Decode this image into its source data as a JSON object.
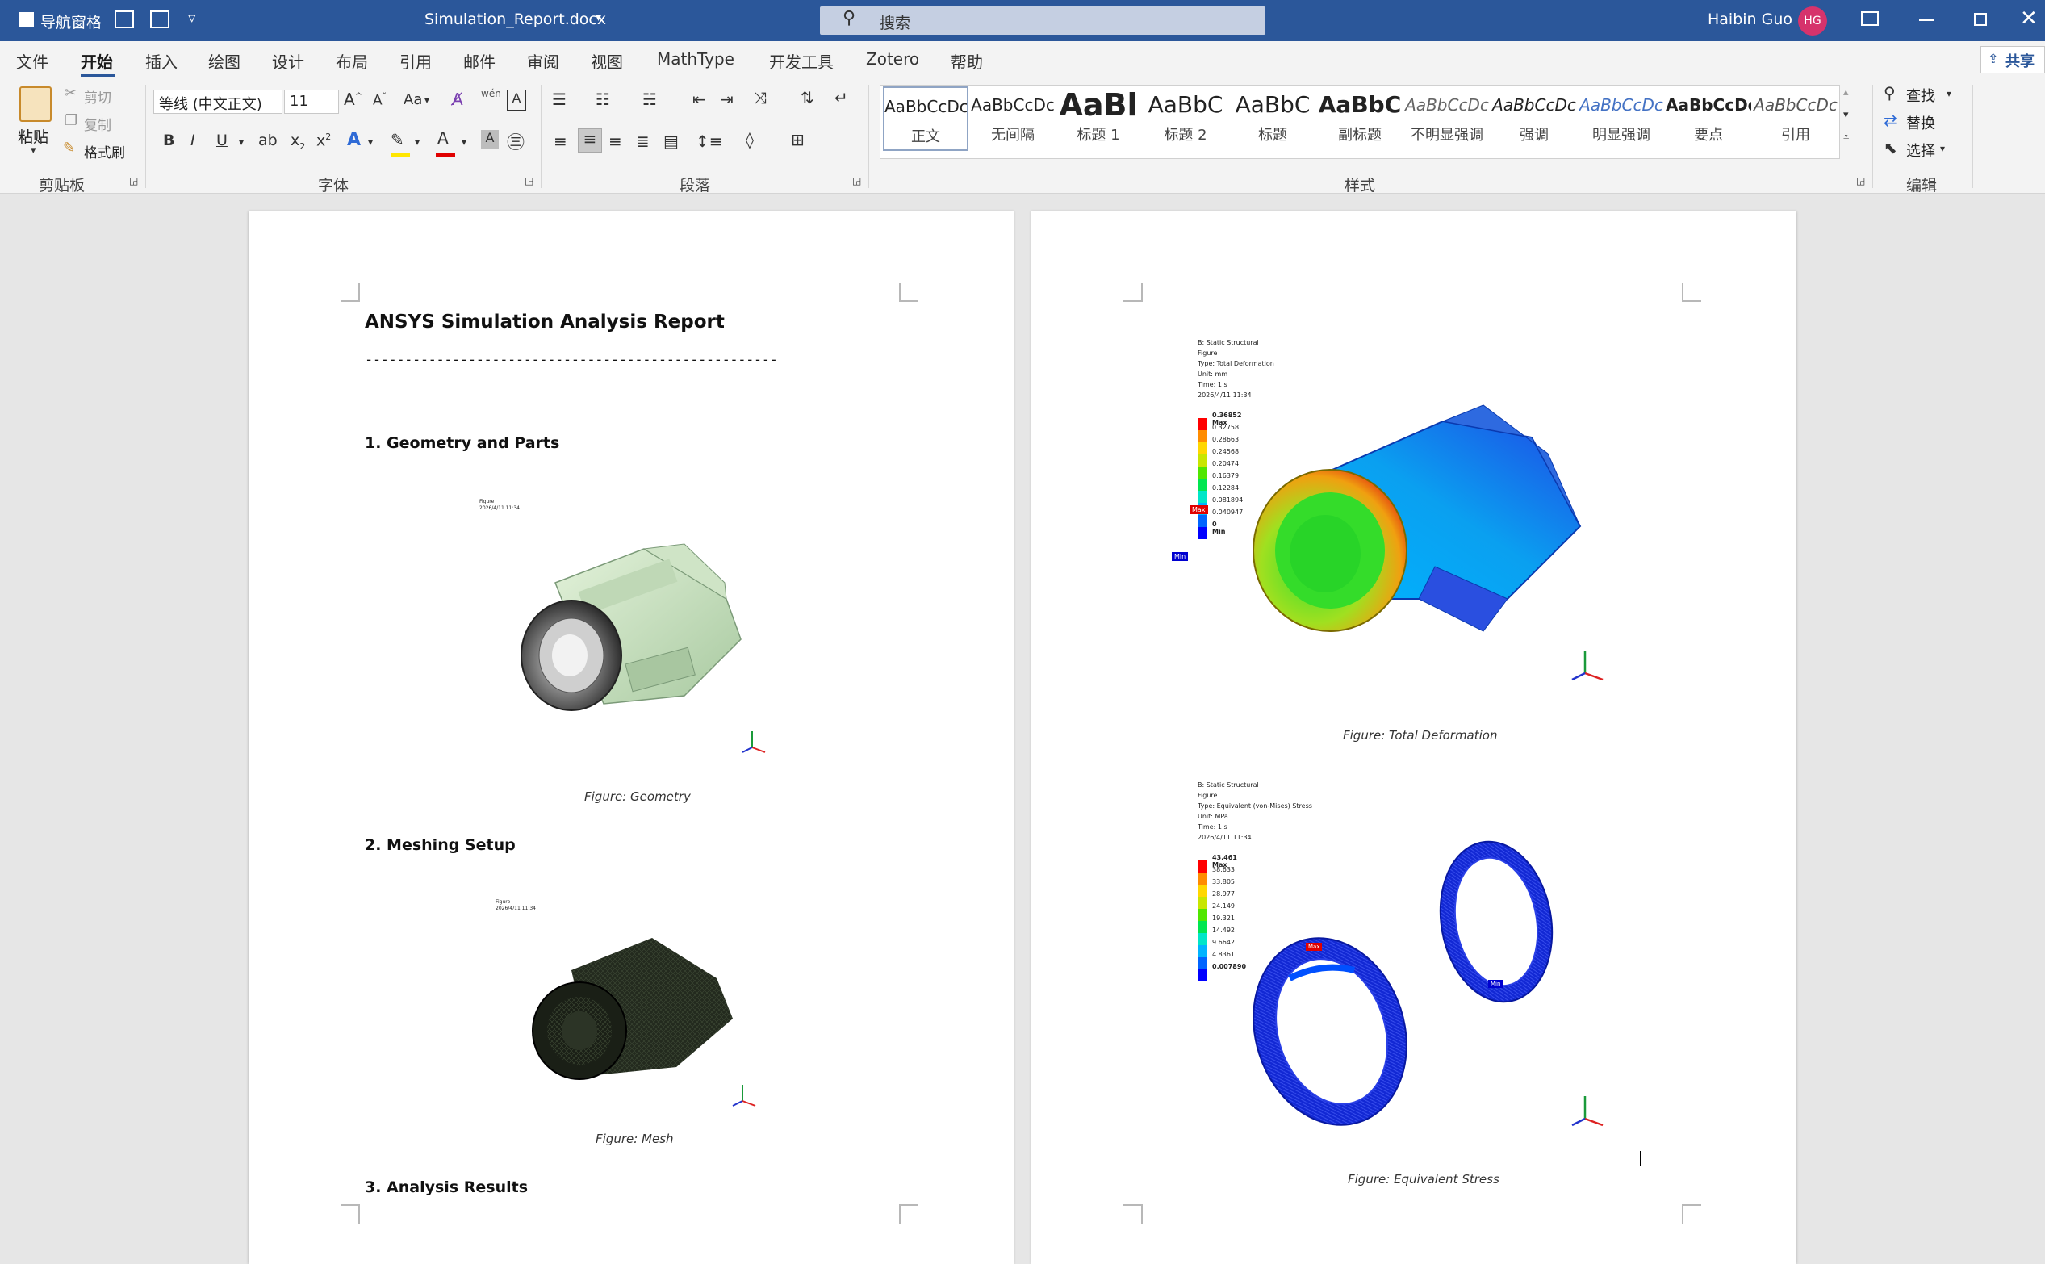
{
  "titlebar": {
    "nav_pane": "导航窗格",
    "doc_name": "Simulation_Report.docx",
    "search_placeholder": "搜索",
    "user_name": "Haibin Guo",
    "user_initials": "HG"
  },
  "tabs": [
    "文件",
    "开始",
    "插入",
    "绘图",
    "设计",
    "布局",
    "引用",
    "邮件",
    "审阅",
    "视图",
    "MathType",
    "开发工具",
    "Zotero",
    "帮助"
  ],
  "share_label": "共享",
  "clipboard": {
    "paste": "粘贴",
    "cut": "剪切",
    "copy": "复制",
    "format_painter": "格式刷",
    "group": "剪贴板"
  },
  "font": {
    "name": "等线 (中文正文)",
    "size": "11",
    "case": "Aa",
    "group": "字体"
  },
  "paragraph": {
    "group": "段落"
  },
  "styles": {
    "group": "样式",
    "items": [
      {
        "preview": "AaBbCcDc",
        "label": "正文"
      },
      {
        "preview": "AaBbCcDc",
        "label": "无间隔"
      },
      {
        "preview": "AaBl",
        "label": "标题 1"
      },
      {
        "preview": "AaBbC",
        "label": "标题 2"
      },
      {
        "preview": "AaBbC",
        "label": "标题"
      },
      {
        "preview": "AaBbC",
        "label": "副标题"
      },
      {
        "preview": "AaBbCcDc",
        "label": "不明显强调"
      },
      {
        "preview": "AaBbCcDc",
        "label": "强调"
      },
      {
        "preview": "AaBbCcDc",
        "label": "明显强调"
      },
      {
        "preview": "AaBbCcDc",
        "label": "要点"
      },
      {
        "preview": "AaBbCcDc",
        "label": "引用"
      }
    ]
  },
  "editing": {
    "find": "查找",
    "replace": "替换",
    "select": "选择",
    "group": "编辑"
  },
  "page1": {
    "title": "ANSYS Simulation Analysis Report",
    "divider": "----------------------------------------------------",
    "h1": "1. Geometry and Parts",
    "fig1_header": "Figure\n2026/4/11 11:34",
    "fig1_caption": "Figure: Geometry",
    "h2": "2. Meshing Setup",
    "fig2_header": "Figure\n2026/4/11 11:34",
    "fig2_caption": "Figure: Mesh",
    "h3": "3. Analysis Results"
  },
  "page2": {
    "fig3": {
      "header": "B: Static Structural\nFigure\nType: Total Deformation\nUnit: mm\nTime: 1 s\n2026/4/11 11:34",
      "legend": [
        "0.36852 Max",
        "0.32758",
        "0.28663",
        "0.24568",
        "0.20474",
        "0.16379",
        "0.12284",
        "0.081894",
        "0.040947",
        "0 Min"
      ],
      "max_tag": "Max",
      "min_tag": "Min",
      "caption": "Figure: Total Deformation"
    },
    "fig4": {
      "header": "B: Static Structural\nFigure\nType: Equivalent (von-Mises) Stress\nUnit: MPa\nTime: 1 s\n2026/4/11 11:34",
      "legend": [
        "43.461 Max",
        "38.633",
        "33.805",
        "28.977",
        "24.149",
        "19.321",
        "14.492",
        "9.6642",
        "4.8361",
        "0.007890"
      ],
      "max_tag": "Max",
      "min_tag": "Min",
      "caption": "Figure: Equivalent Stress"
    }
  },
  "legend_colors": [
    "#ff0000",
    "#ff8c00",
    "#ffd700",
    "#c8e600",
    "#50e600",
    "#00e650",
    "#00e6c8",
    "#00b4ff",
    "#0064ff",
    "#0000ff"
  ]
}
